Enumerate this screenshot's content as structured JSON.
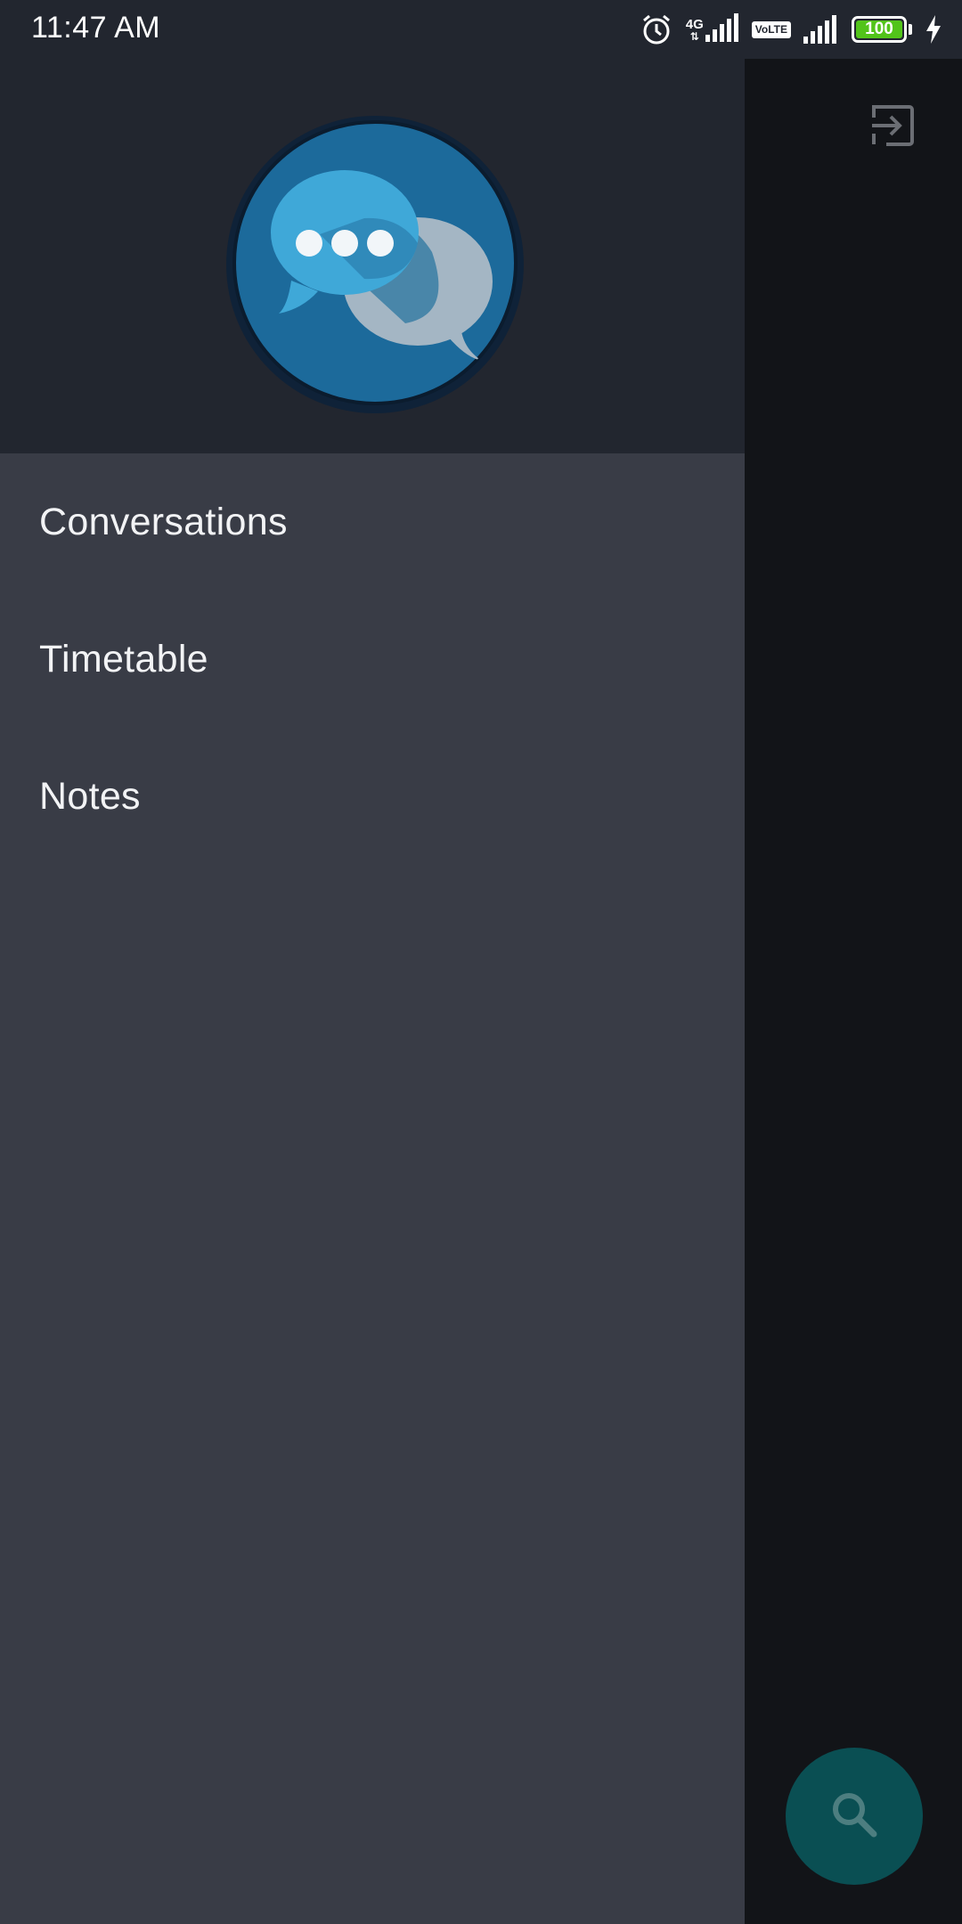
{
  "status_bar": {
    "time": "11:47 AM",
    "network_type": "4G",
    "volte_top": "Vo",
    "volte_bottom": "LTE",
    "battery_level": "100",
    "battery_fraction": 1.0,
    "battery_color": "#52c41a",
    "icons": [
      "alarm-icon",
      "signal-icon",
      "volte-icon",
      "signal-icon",
      "battery-icon",
      "charging-icon"
    ]
  },
  "drawer": {
    "header": {
      "avatar_icon": "chat-bubbles-icon"
    },
    "menu_items": [
      {
        "label": "Conversations"
      },
      {
        "label": "Timetable"
      },
      {
        "label": "Notes"
      }
    ]
  },
  "background_screen": {
    "exit_icon": "exit-icon",
    "fab_icon": "search-icon",
    "fab_color": "#0a4f53"
  }
}
